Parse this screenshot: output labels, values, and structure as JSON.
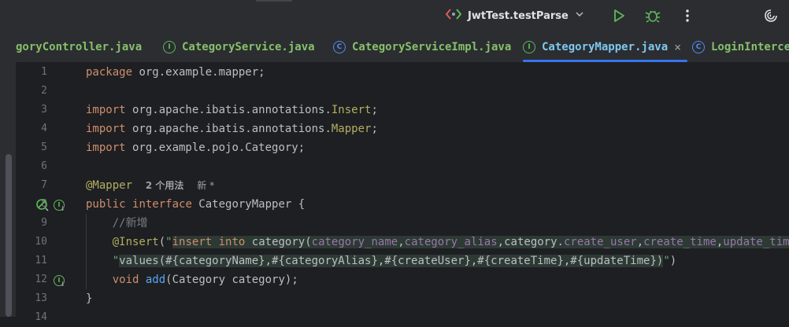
{
  "toolbar": {
    "run_config": "JwtTest.testParse",
    "icons": [
      "run-config-icon",
      "chevron-down-icon",
      "run-icon",
      "debug-icon",
      "more-icon",
      "ai-assistant-icon"
    ]
  },
  "tabs": [
    {
      "label": "goryController.java",
      "type": "",
      "active": false
    },
    {
      "label": "CategoryService.java",
      "type": "I",
      "active": false
    },
    {
      "label": "CategoryServiceImpl.java",
      "type": "C",
      "active": false
    },
    {
      "label": "CategoryMapper.java",
      "type": "I",
      "active": true,
      "close": "×"
    },
    {
      "label": "LoginIntercep",
      "type": "C",
      "active": false
    }
  ],
  "line_numbers": [
    "1",
    "2",
    "3",
    "4",
    "5",
    "6",
    "7",
    "8",
    "9",
    "10",
    "11",
    "12",
    "13",
    "14"
  ],
  "code": {
    "l1_kw": "package",
    "l1_rest": " org.example.mapper;",
    "l3_kw": "import",
    "l3_pkg": " org.apache.ibatis.annotations.",
    "l3_cls": "Insert",
    "l3_end": ";",
    "l4_kw": "import",
    "l4_pkg": " org.apache.ibatis.annotations.",
    "l4_cls": "Mapper",
    "l4_end": ";",
    "l5_kw": "import",
    "l5_rest": " org.example.pojo.Category;",
    "l7_ann": "@Mapper",
    "l7_hint1": "2 个用法",
    "l7_hint2": "新 *",
    "l8_kw1": "public",
    "l8_kw2": "interface",
    "l8_rest": " CategoryMapper {",
    "l9_comment": "//新增",
    "l10_ann": "@Insert",
    "l10_open": "(",
    "l10_q": "\"",
    "l10_sqlkw1": "insert",
    "l10_sqlkw2": "into",
    "l10_tbl": "category(",
    "l10_f1": "category_name",
    "l10_c1": ",",
    "l10_f2": "category_alias",
    "l10_c2": ",category.",
    "l10_f3": "create_user",
    "l10_c3": ",",
    "l10_f4": "create_time",
    "l10_c4": ",",
    "l10_f5": "update_time",
    "l10_close": ")",
    "l10_q2": "\"",
    "l10_plus": "+",
    "l11_q": "\"",
    "l11_values": "values(#{categoryName},#{categoryAlias},#{createUser},#{createTime},#{updateTime})",
    "l11_q2": "\"",
    "l11_end": ")",
    "l12_kw": "void",
    "l12_fn": "add",
    "l12_rest": "(Category category);",
    "l13": "}"
  }
}
